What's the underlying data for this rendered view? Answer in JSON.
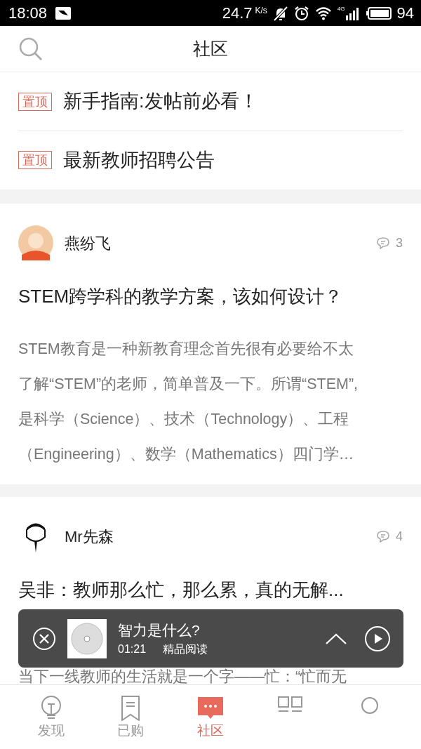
{
  "status_bar": {
    "time": "18:08",
    "speed": "24.7",
    "speed_unit": "K/s",
    "network": "4G",
    "battery": "94"
  },
  "header": {
    "title": "社区"
  },
  "pinned": [
    {
      "badge": "置顶",
      "title": "新手指南:发帖前必看！"
    },
    {
      "badge": "置顶",
      "title": "最新教师招聘公告"
    }
  ],
  "posts": [
    {
      "author": "燕纷飞",
      "kind": "photo",
      "comments": "3",
      "title": "STEM跨学科的教学方案，该如何设计？",
      "excerpt": [
        "STEM教育是一种新教育理念首先很有必要给不太",
        "了解“STEM”的老师，简单普及一下。所谓“STEM”,",
        "是科学（Science）、技术（Technology）、工程",
        "（Engineering）、数学（Mathematics）四门学…"
      ]
    },
    {
      "author": "Mr先森",
      "kind": "cartoon",
      "comments": "4",
      "title": "吴非：教师那么忙，那么累，真的无解...",
      "excerpt": [
        "当下一线教师的生活就是一个字——忙：“忙而无"
      ]
    }
  ],
  "player": {
    "title": "智力是什么?",
    "time": "01:21",
    "category": "精品阅读"
  },
  "tabs": [
    {
      "kind": "bulb",
      "label": "发现",
      "selected": false
    },
    {
      "kind": "bookmark",
      "label": "已购",
      "selected": false
    },
    {
      "kind": "chat",
      "label": "社区",
      "selected": true
    },
    {
      "kind": "grid",
      "selected": false
    },
    {
      "kind": "circle",
      "selected": false
    }
  ]
}
